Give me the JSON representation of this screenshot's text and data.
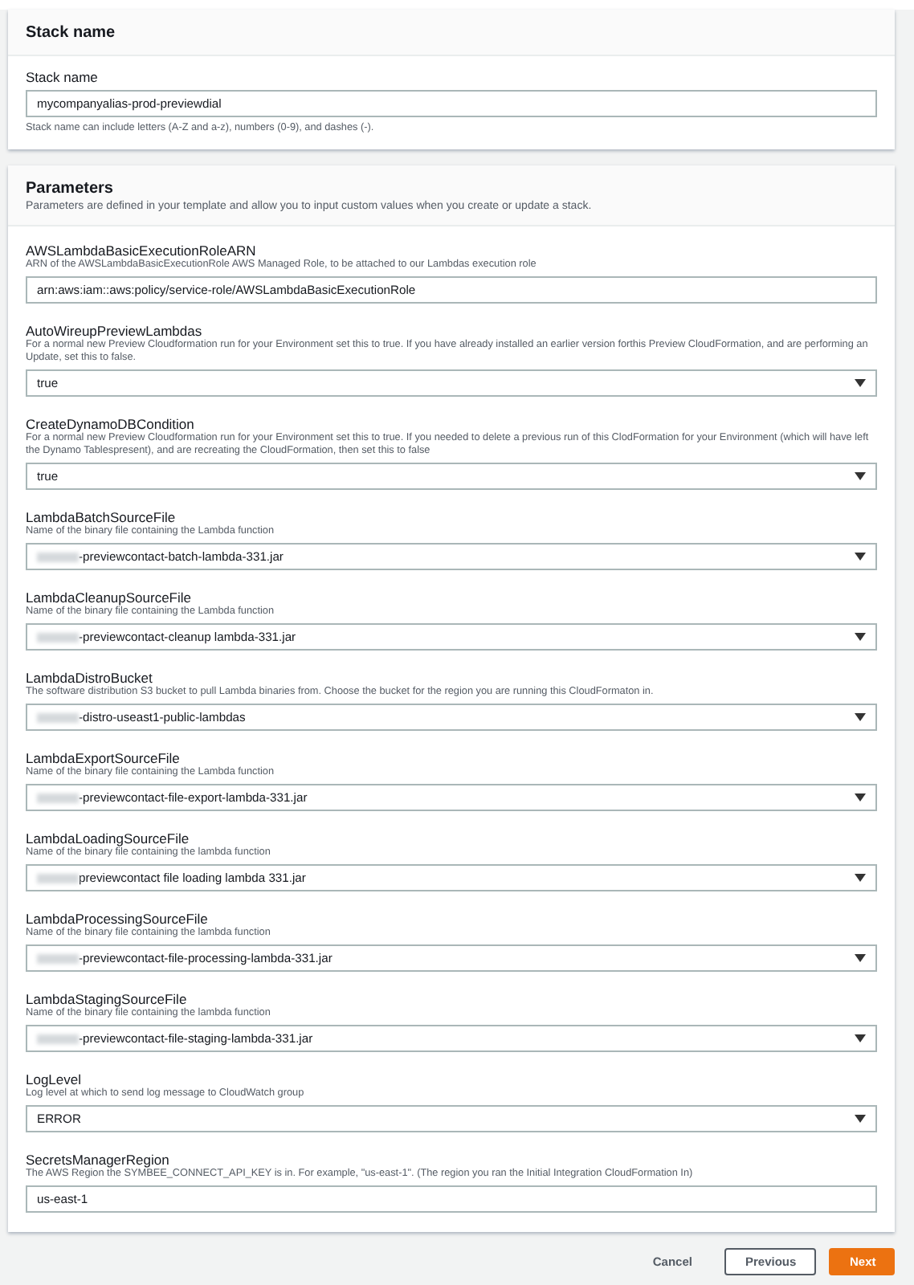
{
  "stack_name_panel": {
    "title": "Stack name",
    "field": {
      "label": "Stack name",
      "value": "mycompanyalias-prod-previewdial",
      "hint": "Stack name can include letters (A-Z and a-z), numbers (0-9), and dashes (-)."
    }
  },
  "parameters_panel": {
    "title": "Parameters",
    "description": "Parameters are defined in your template and allow you to input custom values when you create or update a stack.",
    "fields": [
      {
        "kind": "text",
        "label": "AWSLambdaBasicExecutionRoleARN",
        "description": "ARN of the AWSLambdaBasicExecutionRole AWS Managed Role, to be attached to our Lambdas execution role",
        "value": "arn:aws:iam::aws:policy/service-role/AWSLambdaBasicExecutionRole",
        "redacted": false
      },
      {
        "kind": "select",
        "label": "AutoWireupPreviewLambdas",
        "description": "For a normal new Preview Cloudformation run for your Environment set this to true. If you have already installed an earlier version forthis Preview CloudFormation, and are performing an Update, set this to false.",
        "value": "true",
        "redacted": false
      },
      {
        "kind": "select",
        "label": "CreateDynamoDBCondition",
        "description": "For a normal new Preview Cloudformation run for your Environment set this to true. If you needed to delete a previous run of this ClodFormation for your Environment (which will have left the Dynamo Tablespresent), and are recreating the CloudFormation, then set this to false",
        "value": "true",
        "redacted": false
      },
      {
        "kind": "select",
        "label": "LambdaBatchSourceFile",
        "description": "Name of the binary file containing the Lambda function",
        "value": "-previewcontact-batch-lambda-331.jar",
        "redacted": true
      },
      {
        "kind": "select",
        "label": "LambdaCleanupSourceFile",
        "description": "Name of the binary file containing the Lambda function",
        "value": "-previewcontact-cleanup lambda-331.jar",
        "redacted": true
      },
      {
        "kind": "select",
        "label": "LambdaDistroBucket",
        "description": "The software distribution S3 bucket to pull Lambda binaries from. Choose the bucket for the region you are running this CloudFormaton in.",
        "value": "-distro-useast1-public-lambdas",
        "redacted": true
      },
      {
        "kind": "select",
        "label": "LambdaExportSourceFile",
        "description": "Name of the binary file containing the Lambda function",
        "value": "-previewcontact-file-export-lambda-331.jar",
        "redacted": true
      },
      {
        "kind": "select",
        "label": "LambdaLoadingSourceFile",
        "description": "Name of the binary file containing the lambda function",
        "value": "previewcontact file loading lambda 331.jar",
        "redacted": true
      },
      {
        "kind": "select",
        "label": "LambdaProcessingSourceFile",
        "description": "Name of the binary file containing the lambda function",
        "value": "-previewcontact-file-processing-lambda-331.jar",
        "redacted": true
      },
      {
        "kind": "select",
        "label": "LambdaStagingSourceFile",
        "description": "Name of the binary file containing the lambda function",
        "value": "-previewcontact-file-staging-lambda-331.jar",
        "redacted": true
      },
      {
        "kind": "select",
        "label": "LogLevel",
        "description": "Log level at which to send log message to CloudWatch group",
        "value": "ERROR",
        "redacted": false
      },
      {
        "kind": "text",
        "label": "SecretsManagerRegion",
        "description": "The AWS Region the SYMBEE_CONNECT_API_KEY is in. For example, \"us-east-1\". (The region you ran the Initial Integration CloudFormation In)",
        "value": "us-east-1",
        "redacted": false
      }
    ]
  },
  "actions": [
    {
      "kind": "link",
      "label": "Cancel"
    },
    {
      "kind": "secondary",
      "label": "Previous"
    },
    {
      "kind": "primary",
      "label": "Next"
    }
  ]
}
